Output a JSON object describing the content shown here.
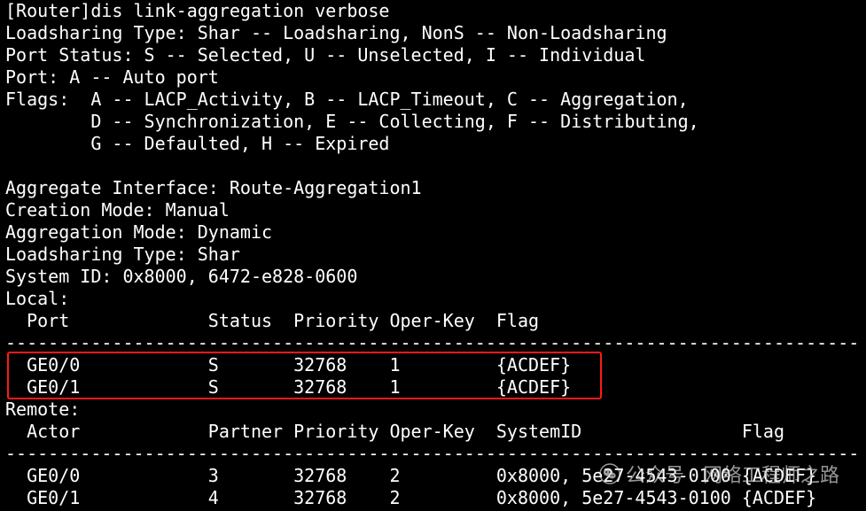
{
  "terminal": {
    "lines": [
      "[Router]dis link-aggregation verbose",
      "Loadsharing Type: Shar -- Loadsharing, NonS -- Non-Loadsharing",
      "Port Status: S -- Selected, U -- Unselected, I -- Individual",
      "Port: A -- Auto port",
      "Flags:  A -- LACP_Activity, B -- LACP_Timeout, C -- Aggregation,",
      "        D -- Synchronization, E -- Collecting, F -- Distributing,",
      "        G -- Defaulted, H -- Expired",
      "",
      "Aggregate Interface: Route-Aggregation1",
      "Creation Mode: Manual",
      "Aggregation Mode: Dynamic",
      "Loadsharing Type: Shar",
      "System ID: 0x8000, 6472-e828-0600",
      "Local:",
      "  Port             Status  Priority Oper-Key  Flag",
      "--------------------------------------------------------------------------------",
      "  GE0/0            S       32768    1         {ACDEF}",
      "  GE0/1            S       32768    1         {ACDEF}",
      "Remote:",
      "  Actor            Partner Priority Oper-Key  SystemID               Flag",
      "--------------------------------------------------------------------------------",
      "  GE0/0            3       32768    2         0x8000, 5e27-4543-0100 {ACDEF}",
      "  GE0/1            4       32768    2         0x8000, 5e27-4543-0100 {ACDEF}"
    ],
    "highlight_color": "#ff1a1a"
  },
  "watermark": {
    "icon": "wechat-icon",
    "text": "公众号 · 网络工程师之路"
  }
}
